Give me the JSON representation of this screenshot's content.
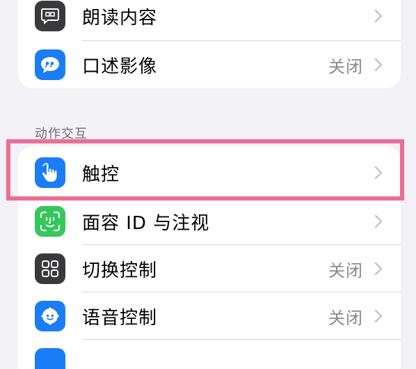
{
  "section_top": {
    "rows": [
      {
        "label": "朗读内容",
        "value": "",
        "icon": "speech-bubble-icon",
        "icon_bg": "#3a3a3c"
      },
      {
        "label": "口述影像",
        "value": "关闭",
        "icon": "quote-bubble-icon",
        "icon_bg": "#1a7df5"
      }
    ]
  },
  "section_interaction": {
    "header": "动作交互",
    "rows": [
      {
        "label": "触控",
        "value": "",
        "icon": "hand-touch-icon",
        "icon_bg": "#1a7df5"
      },
      {
        "label": "面容 ID 与注视",
        "value": "",
        "icon": "face-id-icon",
        "icon_bg": "#34c759"
      },
      {
        "label": "切换控制",
        "value": "关闭",
        "icon": "switch-grid-icon",
        "icon_bg": "#3a3a3c"
      },
      {
        "label": "语音控制",
        "value": "关闭",
        "icon": "voice-control-icon",
        "icon_bg": "#1a7df5"
      }
    ]
  },
  "colors": {
    "highlight": "#ef6d93",
    "chevron": "#c4c4c7"
  }
}
